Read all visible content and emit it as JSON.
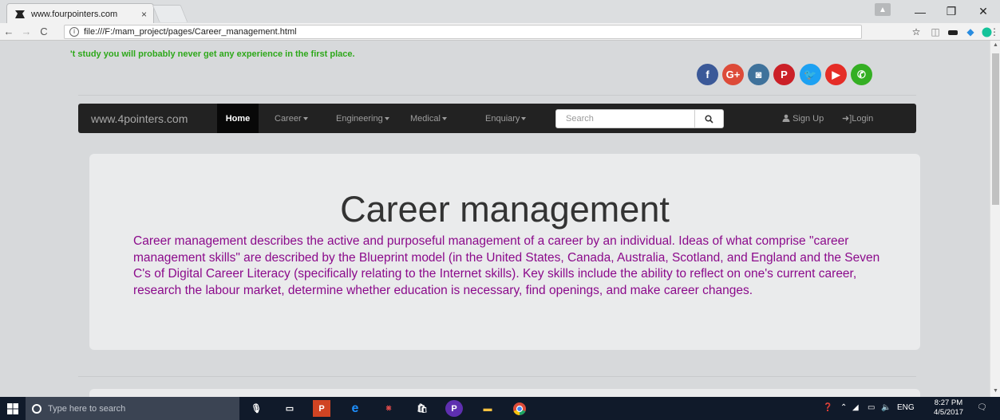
{
  "browser": {
    "tab_title": "www.fourpointers.com",
    "tab_close": "×",
    "url": "file:///F:/mam_project/pages/Career_management.html",
    "window_controls": [
      "—",
      "❐",
      "✕"
    ]
  },
  "page": {
    "marquee": "'t study you will probably never get any experience in the first place.",
    "social_icons": [
      {
        "name": "facebook-icon",
        "glyph": "f",
        "color": "#3b5998"
      },
      {
        "name": "google-plus-icon",
        "glyph": "G+",
        "color": "#dd4b39"
      },
      {
        "name": "instagram-icon",
        "glyph": "◙",
        "color": "#3f729b"
      },
      {
        "name": "pinterest-icon",
        "glyph": "P",
        "color": "#cb2027"
      },
      {
        "name": "twitter-icon",
        "glyph": "🐦",
        "color": "#1da1f2"
      },
      {
        "name": "youtube-icon",
        "glyph": "▶",
        "color": "#e52d27"
      },
      {
        "name": "whatsapp-icon",
        "glyph": "✆",
        "color": "#34af23"
      }
    ],
    "navbar": {
      "brand": "www.4pointers.com",
      "home": "Home",
      "items": [
        "Career",
        "Engineering",
        "Medical",
        "Enquiary"
      ],
      "search_placeholder": "Search",
      "sign_up": "Sign Up",
      "login": "Login"
    },
    "article": {
      "title": "Career management",
      "body": "Career management describes the active and purposeful management of a career by an individual. Ideas of what comprise \"career management skills\" are described by the Blueprint model (in the United States, Canada, Australia, Scotland, and England and the Seven C's of Digital Career Literacy (specifically relating to the Internet skills). Key skills include the ability to reflect on one's current career, research the labour market, determine whether education is necessary, find openings, and make career changes."
    }
  },
  "taskbar": {
    "search_placeholder": "Type here to search",
    "language": "ENG",
    "time": "8:27 PM",
    "date": "4/5/2017"
  }
}
